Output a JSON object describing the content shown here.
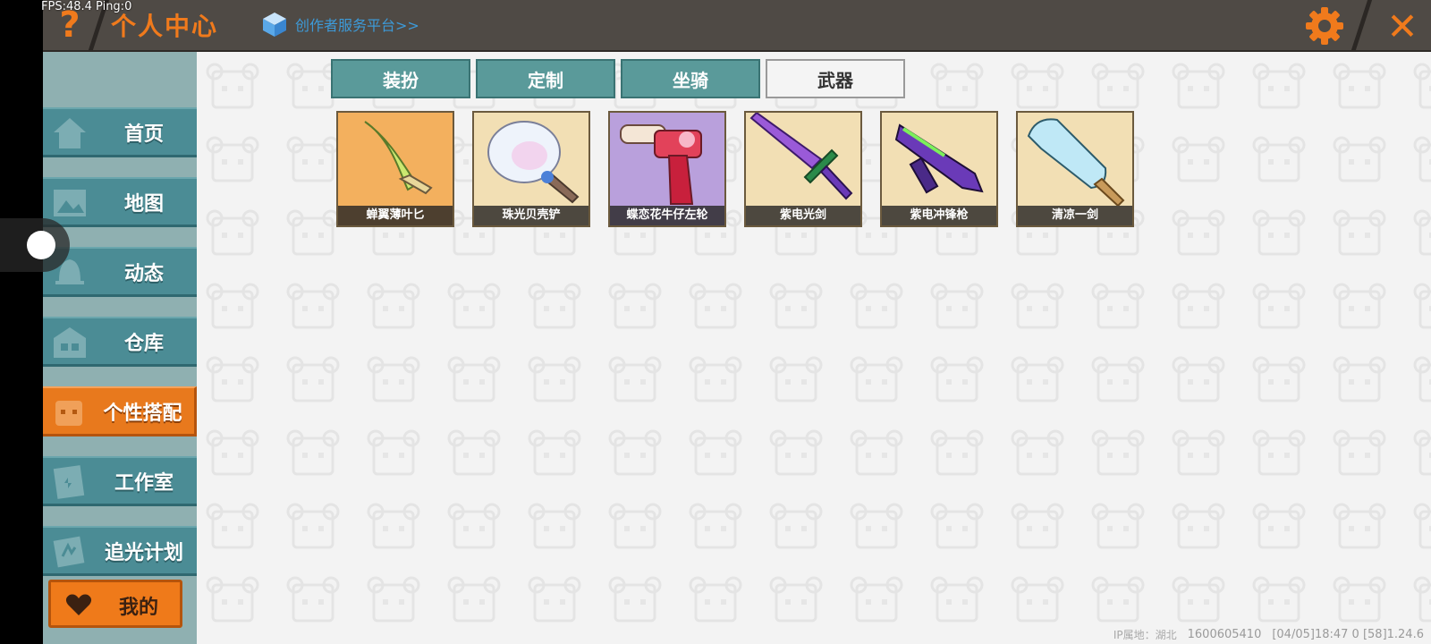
{
  "debug": {
    "fps_text": "FPS:48.4  Ping:0"
  },
  "header": {
    "help_label": "?",
    "title": "个人中心",
    "creator_link": "创作者服务平台>>",
    "close_label": "✕"
  },
  "sidebar": {
    "items": [
      {
        "label": "首页",
        "icon": "house-icon"
      },
      {
        "label": "地图",
        "icon": "map-icon"
      },
      {
        "label": "动态",
        "icon": "bell-icon"
      },
      {
        "label": "仓库",
        "icon": "storage-icon"
      },
      {
        "label": "个性搭配",
        "icon": "character-icon",
        "active": true
      },
      {
        "label": "工作室",
        "icon": "studio-icon"
      },
      {
        "label": "追光计划",
        "icon": "plan-icon"
      }
    ],
    "mine_label": "我的"
  },
  "tabs": [
    {
      "label": "装扮"
    },
    {
      "label": "定制"
    },
    {
      "label": "坐骑"
    },
    {
      "label": "武器",
      "active": true
    }
  ],
  "weapons": [
    {
      "name": "蝉翼薄叶匕",
      "bg": "#f0a44e"
    },
    {
      "name": "珠光贝壳铲",
      "bg": "#f0d9a8"
    },
    {
      "name": "蝶恋花牛仔左轮",
      "bg": "#b49ad8"
    },
    {
      "name": "紫电光剑",
      "bg": "#f0d9a8"
    },
    {
      "name": "紫电冲锋枪",
      "bg": "#f0d9a8"
    },
    {
      "name": "清凉一剑",
      "bg": "#f0d9a8"
    }
  ],
  "footer": {
    "ip_location": "IP属地：湖北",
    "uid": "1600605410",
    "status": "[04/05]18:47 0  [58]1.24.6"
  },
  "colors": {
    "accent": "#f07a1c",
    "nav": "#4b8c95",
    "active": "#e8791d",
    "tab": "#5a9a9a"
  }
}
